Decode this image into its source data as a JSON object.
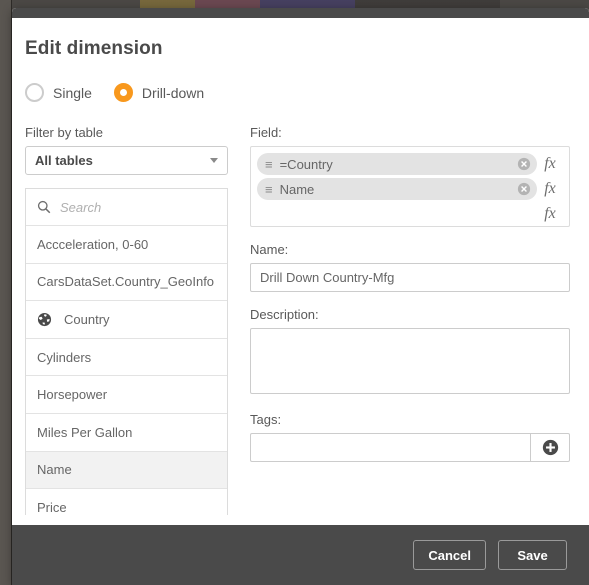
{
  "dialog": {
    "title": "Edit dimension",
    "mode_options": [
      {
        "label": "Single",
        "selected": false
      },
      {
        "label": "Drill-down",
        "selected": true
      }
    ],
    "accent_color": "#f8981d",
    "footer_bg": "#4a4a4a"
  },
  "left_panel": {
    "filter_label": "Filter by table",
    "table_select_value": "All tables",
    "search_placeholder": "Search",
    "search_value": "",
    "items": [
      {
        "label": "Accceleration, 0-60",
        "icon": "",
        "selected": false
      },
      {
        "label": "CarsDataSet.Country_GeoInfo",
        "icon": "",
        "selected": false
      },
      {
        "label": "Country",
        "icon": "globe-icon",
        "selected": false
      },
      {
        "label": "Cylinders",
        "icon": "",
        "selected": false
      },
      {
        "label": "Horsepower",
        "icon": "",
        "selected": false
      },
      {
        "label": "Miles Per Gallon",
        "icon": "",
        "selected": false
      },
      {
        "label": "Name",
        "icon": "",
        "selected": true
      },
      {
        "label": "Price",
        "icon": "",
        "selected": false
      }
    ]
  },
  "right_panel": {
    "field_label": "Field:",
    "chips": [
      {
        "text": "=Country",
        "handle": "≡",
        "fx": "fx"
      },
      {
        "text": "Name",
        "handle": "≡",
        "fx": "fx"
      }
    ],
    "extra_fx": "fx",
    "name_label": "Name:",
    "name_value": "Drill Down Country-Mfg",
    "description_label": "Description:",
    "description_value": "",
    "tags_label": "Tags:",
    "tags_value": "",
    "tags_add_icon": "plus-circle-icon"
  },
  "footer": {
    "cancel_label": "Cancel",
    "save_label": "Save"
  }
}
